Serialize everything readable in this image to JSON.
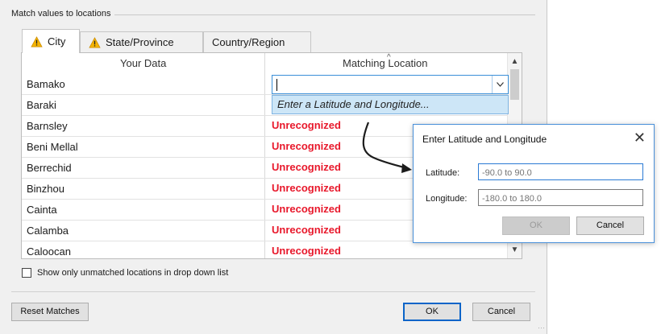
{
  "group_label": "Match values to locations",
  "tabs": [
    {
      "label": "City",
      "warning": true,
      "active": true
    },
    {
      "label": "State/Province",
      "warning": true,
      "active": false
    },
    {
      "label": "Country/Region",
      "warning": false,
      "active": false
    }
  ],
  "table": {
    "headers": {
      "your_data": "Your Data",
      "matching_location": "Matching Location"
    },
    "rows": [
      {
        "name": "Bamako",
        "match": ""
      },
      {
        "name": "Baraki",
        "match": ""
      },
      {
        "name": "Barnsley",
        "match": "Unrecognized"
      },
      {
        "name": "Beni Mellal",
        "match": "Unrecognized"
      },
      {
        "name": "Berrechid",
        "match": "Unrecognized"
      },
      {
        "name": "Binzhou",
        "match": "Unrecognized"
      },
      {
        "name": "Cainta",
        "match": "Unrecognized"
      },
      {
        "name": "Calamba",
        "match": "Unrecognized"
      },
      {
        "name": "Caloocan",
        "match": "Unrecognized"
      }
    ]
  },
  "combo": {
    "value": "",
    "dropdown_option": "Enter a Latitude and Longitude..."
  },
  "checkbox": {
    "label": "Show only unmatched locations in drop down list",
    "checked": false
  },
  "buttons": {
    "reset": "Reset Matches",
    "ok": "OK",
    "cancel": "Cancel"
  },
  "popup": {
    "title": "Enter Latitude and Longitude",
    "latitude_label": "Latitude:",
    "latitude_placeholder": "-90.0 to 90.0",
    "longitude_label": "Longitude:",
    "longitude_placeholder": "-180.0 to 180.0",
    "ok": "OK",
    "cancel": "Cancel",
    "close_icon": "close-icon"
  },
  "colors": {
    "unrecognized": "#e8182b",
    "accent": "#3a8fd8",
    "warning": "#f5b400"
  }
}
